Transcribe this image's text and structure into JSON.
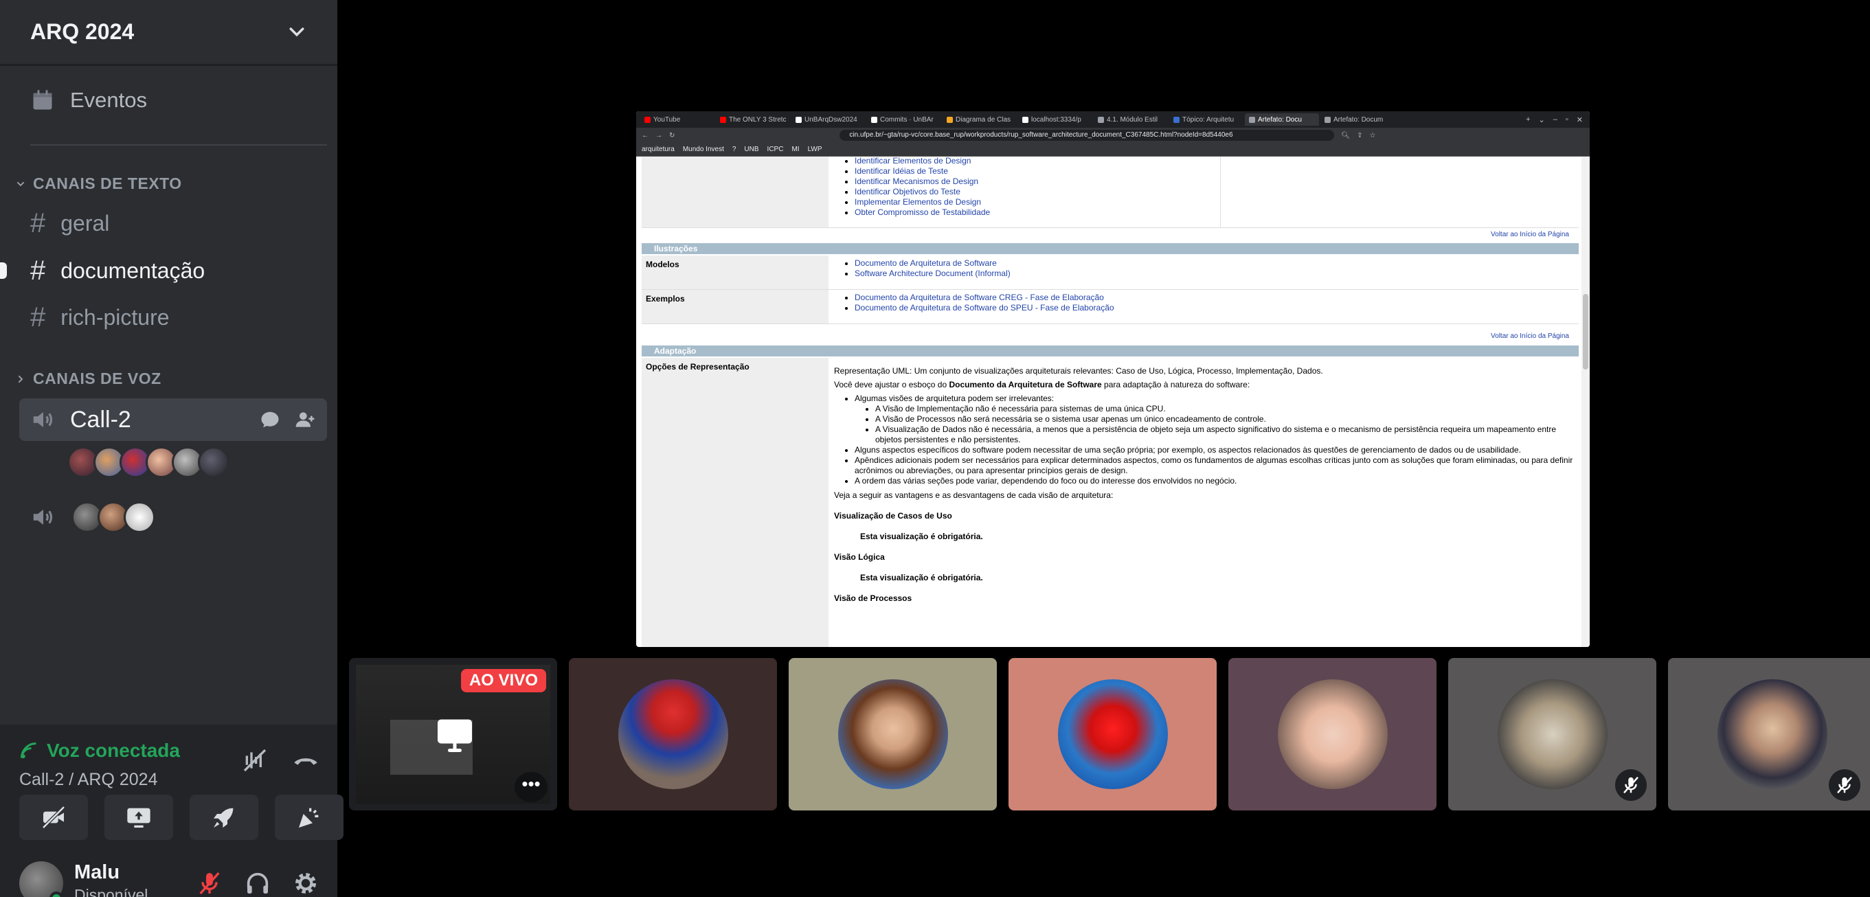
{
  "server": {
    "name": "ARQ 2024"
  },
  "sidebar": {
    "events_label": "Eventos",
    "text_category": "CANAIS DE TEXTO",
    "text_channels": [
      {
        "name": "geral",
        "active": false
      },
      {
        "name": "documentação",
        "active": true
      },
      {
        "name": "rich-picture",
        "active": false
      }
    ],
    "voice_category": "CANAIS DE VOZ",
    "voice_channel": "Call-2"
  },
  "voice_panel": {
    "status": "Voz conectada",
    "location": "Call-2 / ARQ 2024"
  },
  "user": {
    "name": "Malu",
    "status": "Disponível"
  },
  "stream": {
    "live_label": "AO VIVO",
    "more_label": "•••",
    "tabs": [
      {
        "label": "YouTube",
        "color": "#ff0000",
        "active": false
      },
      {
        "label": "The ONLY 3 Stretc",
        "color": "#ff0000",
        "active": false
      },
      {
        "label": "UnBArqDsw2024",
        "color": "#ffffff",
        "active": false
      },
      {
        "label": "Commits · UnBAr",
        "color": "#ffffff",
        "active": false
      },
      {
        "label": "Diagrama de Clas",
        "color": "#f5a623",
        "active": false
      },
      {
        "label": "localhost:3334/p",
        "color": "#ffffff",
        "active": false
      },
      {
        "label": "4.1. Módulo Estil",
        "color": "#9aa0a6",
        "active": false
      },
      {
        "label": "Tópico: Arquitetu",
        "color": "#3b6fd1",
        "active": false
      },
      {
        "label": "Artefato: Docu",
        "color": "#9aa0a6",
        "active": true
      },
      {
        "label": "Artefato: Docum",
        "color": "#9aa0a6",
        "active": false
      }
    ],
    "url": "cin.ufpe.br/~gta/rup-vc/core.base_rup/workproducts/rup_software_architecture_document_C367485C.html?nodeId=8d5440e6",
    "bookmarks": [
      "arquitetura",
      "Mundo Invest",
      "?",
      "UNB",
      "ICPC",
      "MI",
      "LWP"
    ],
    "page": {
      "top_links": [
        "Identificar Elementos de Design",
        "Identificar Idéias de Teste",
        "Identificar Mecanismos de Design",
        "Identificar Objetivos do Teste",
        "Implementar Elementos de Design",
        "Obter Compromisso de Testabilidade"
      ],
      "back_to_top": "Voltar ao Início da Página",
      "illus_title": "Ilustrações",
      "modelos_label": "Modelos",
      "modelos_links": [
        "Documento de Arquitetura de Software",
        "Software Architecture Document (Informal)"
      ],
      "exemplos_label": "Exemplos",
      "exemplos_links": [
        "Documento da Arquitetura de Software CREG - Fase de Elaboração",
        "Documento de Arquitetura de Software do SPEU - Fase de Elaboração"
      ],
      "adapt_title": "Adaptação",
      "rep_label": "Opções de Representação",
      "rep_p1": "Representação UML: Um conjunto de visualizações arquiteturais relevantes: Caso de Uso, Lógica, Processo, Implementação, Dados.",
      "rep_p2_a": "Você deve ajustar o esboço do ",
      "rep_p2_b": "Documento da Arquitetura de Software",
      "rep_p2_c": " para adaptação à natureza do software:",
      "rep_list": [
        "Algumas visões de arquitetura podem ser irrelevantes:",
        "Alguns aspectos específicos do software podem necessitar de uma seção própria; por exemplo, os aspectos relacionados às questões de gerenciamento de dados ou de usabilidade.",
        "Apêndices adicionais podem ser necessários para explicar determinados aspectos, como os fundamentos de algumas escolhas críticas junto com as soluções que foram eliminadas, ou para definir acrônimos ou abreviações, ou para apresentar princípios gerais de design.",
        "A ordem das várias seções pode variar, dependendo do foco ou do interesse dos envolvidos no negócio."
      ],
      "rep_sublist": [
        "A Visão de Implementação não é necessária para sistemas de uma única CPU.",
        "A Visão de Processos não será necessária se o sistema usar apenas um único encadeamento de controle.",
        "A Visualização de Dados não é necessária, a menos que a persistência de objeto seja um aspecto significativo do sistema e o mecanismo de persistência requeira um mapeamento entre objetos persistentes e não persistentes."
      ],
      "rep_p3": "Veja a seguir as vantagens e as desvantagens de cada visão de arquitetura:",
      "view1": "Visualização de Casos de Uso",
      "view1_note": "Esta visualização é obrigatória.",
      "view2": "Visão Lógica",
      "view2_note": "Esta visualização é obrigatória.",
      "view3": "Visão de Processos"
    }
  },
  "colors": {
    "sidebar_bg": "#2b2d31",
    "accent_green": "#23a55a",
    "live_red": "#f23f43",
    "muted_red": "#f23f43"
  }
}
